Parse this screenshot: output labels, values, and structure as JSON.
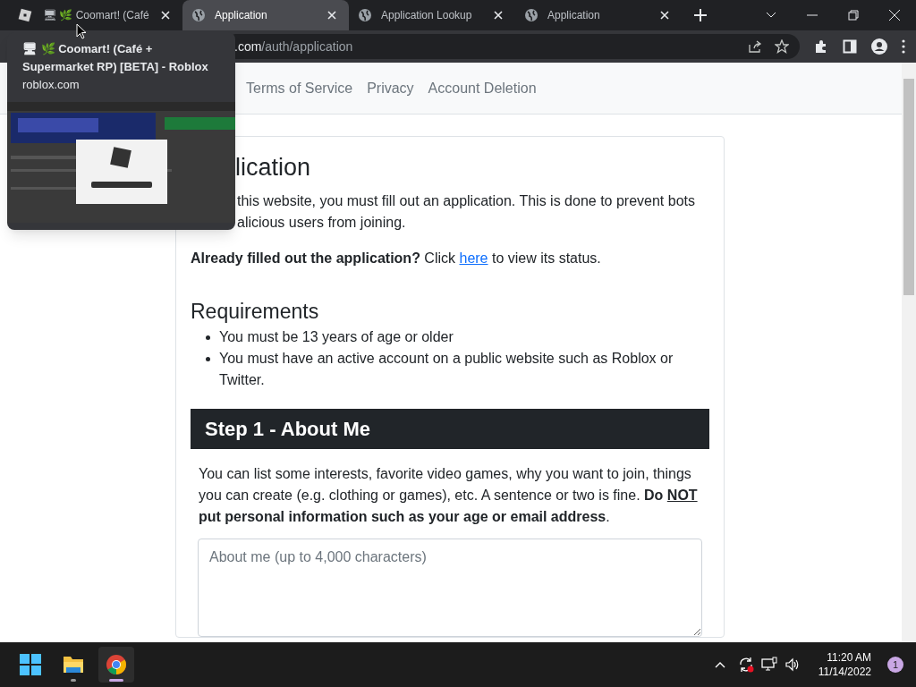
{
  "tabs": [
    {
      "title": "🖥 🌿 Coomart! (Café",
      "kind": "roblox",
      "selected": false
    },
    {
      "title": "Application",
      "kind": "globe",
      "selected": true
    },
    {
      "title": "Application Lookup",
      "kind": "globe",
      "selected": false
    },
    {
      "title": "Application",
      "kind": "globe",
      "selected": false
    }
  ],
  "hover_card": {
    "title": "🖥 🌿 Coomart! (Café + Supermarket RP) [BETA] - Roblox",
    "domain": "roblox.com"
  },
  "address_bar": {
    "host_part": ".com",
    "path": "/auth/application"
  },
  "navbar": {
    "links": [
      "Terms of Service",
      "Privacy",
      "Account Deletion"
    ]
  },
  "card": {
    "heading": "lication",
    "intro_lines": [
      "this website, you must fill out an application. This is done to prevent bots",
      "alicious users from joining."
    ],
    "status_line": {
      "bold": "Already filled out the application?",
      "before": " Click ",
      "link": "here",
      "after": " to view its status."
    },
    "requirements_title": "Requirements",
    "requirements": [
      "You must be 13 years of age or older",
      "You must have an active account on a public website such as Roblox or Twitter."
    ],
    "step": {
      "title": "Step 1 - About Me",
      "description": {
        "text": "You can list some interests, favorite video games, why you want to join, things you can create (e.g. clothing or games), etc. A sentence or two is fine. ",
        "bold_before": "Do ",
        "bold_underlined": "NOT",
        "bold_after": " put personal information such as your age or email address",
        "tail": "."
      },
      "placeholder": "About me (up to 4,000 characters)"
    }
  },
  "taskbar": {
    "apps": [
      {
        "kind": "start",
        "selected": false
      },
      {
        "kind": "folder",
        "selected": false
      },
      {
        "kind": "chrome",
        "selected": true
      }
    ],
    "time": "11:20 AM",
    "date": "11/14/2022",
    "notification_count": "1"
  }
}
